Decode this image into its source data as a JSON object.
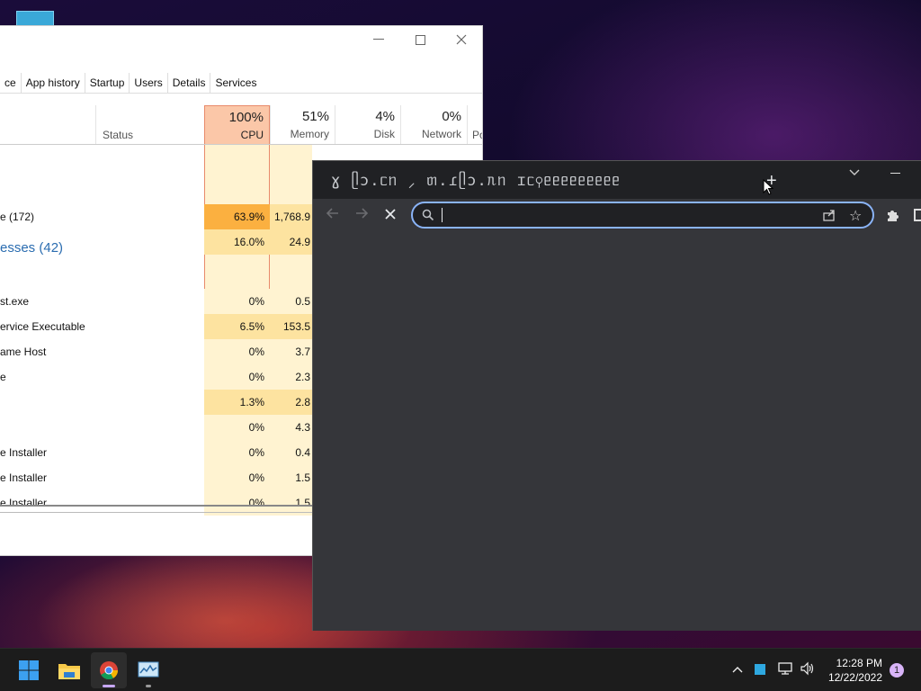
{
  "task_manager": {
    "tabs": [
      "ce",
      "App history",
      "Startup",
      "Users",
      "Details",
      "Services"
    ],
    "columns": {
      "status": "Status",
      "cpu": {
        "percent": "100%",
        "label": "CPU"
      },
      "memory": {
        "percent": "51%",
        "label": "Memory"
      },
      "disk": {
        "percent": "4%",
        "label": "Disk"
      },
      "network": {
        "percent": "0%",
        "label": "Network"
      },
      "power": "Po"
    },
    "group_label": "esses (42)",
    "rows": [
      {
        "name": "e (172)",
        "cpu": "63.9%",
        "mem": "1,768.9"
      },
      {
        "name": "",
        "cpu": "16.0%",
        "mem": "24.9"
      },
      {
        "name": "st.exe",
        "cpu": "0%",
        "mem": "0.5"
      },
      {
        "name": "ervice Executable",
        "cpu": "6.5%",
        "mem": "153.5"
      },
      {
        "name": "ame Host",
        "cpu": "0%",
        "mem": "3.7"
      },
      {
        "name": "e",
        "cpu": "0%",
        "mem": "2.3"
      },
      {
        "name": "",
        "cpu": "1.3%",
        "mem": "2.8"
      },
      {
        "name": "",
        "cpu": "0%",
        "mem": "4.3"
      },
      {
        "name": "e Installer",
        "cpu": "0%",
        "mem": "0.4"
      },
      {
        "name": "e Installer",
        "cpu": "0%",
        "mem": "1.5"
      },
      {
        "name": "e Installer",
        "cpu": "0%",
        "mem": "1.5"
      }
    ]
  },
  "chrome": {
    "tab_title": "ɣ ᥫɔ.ᥴᥒ ⸝ ᥖ.ɾᥫɔ.ᥰᥒ ɪᥴ⚲ᥱᥱᥱᥱᥱᥱᥱᥱᥱ",
    "new_tab": "+",
    "omnibox_value": ""
  },
  "taskbar": {
    "apps": [
      "windows-start",
      "file-explorer",
      "chrome",
      "task-manager"
    ],
    "time": "12:28 PM",
    "date": "12/22/2022",
    "notification_count": "1"
  },
  "colors": {
    "cpu_high": "#fbb040",
    "cpu_mid": "#fde3a0",
    "cpu_low": "#fff3d1",
    "accent": "#8ab4f8"
  }
}
